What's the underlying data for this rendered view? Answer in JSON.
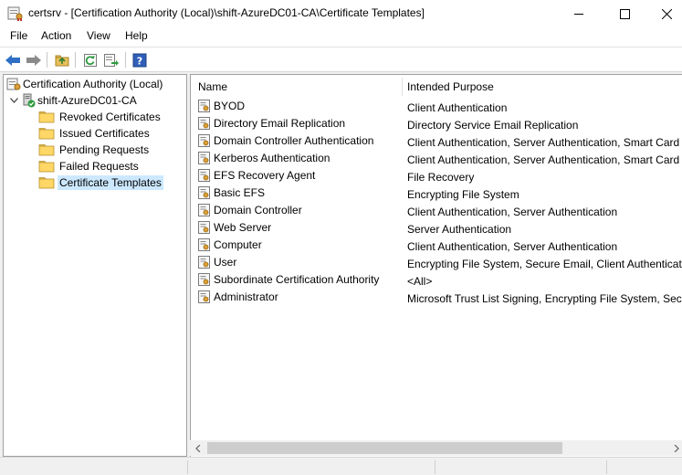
{
  "window": {
    "title": "certsrv - [Certification Authority (Local)\\shift-AzureDC01-CA\\Certificate Templates]"
  },
  "menu": [
    "File",
    "Action",
    "View",
    "Help"
  ],
  "toolbar": {
    "icons": [
      "back-arrow-icon",
      "forward-arrow-icon",
      "up-folder-icon",
      "refresh-icon",
      "export-list-icon",
      "help-icon"
    ]
  },
  "tree": {
    "root": "Certification Authority (Local)",
    "ca": "shift-AzureDC01-CA",
    "children": [
      "Revoked Certificates",
      "Issued Certificates",
      "Pending Requests",
      "Failed Requests",
      "Certificate Templates"
    ],
    "selected": "Certificate Templates"
  },
  "list": {
    "columns": [
      "Name",
      "Intended Purpose"
    ],
    "rows": [
      {
        "name": "BYOD",
        "purpose": "Client Authentication"
      },
      {
        "name": "Directory Email Replication",
        "purpose": "Directory Service Email Replication"
      },
      {
        "name": "Domain Controller Authentication",
        "purpose": "Client Authentication, Server Authentication, Smart Card Logon"
      },
      {
        "name": "Kerberos Authentication",
        "purpose": "Client Authentication, Server Authentication, Smart Card Logon, KDC Authentication"
      },
      {
        "name": "EFS Recovery Agent",
        "purpose": "File Recovery"
      },
      {
        "name": "Basic EFS",
        "purpose": "Encrypting File System"
      },
      {
        "name": "Domain Controller",
        "purpose": "Client Authentication, Server Authentication"
      },
      {
        "name": "Web Server",
        "purpose": "Server Authentication"
      },
      {
        "name": "Computer",
        "purpose": "Client Authentication, Server Authentication"
      },
      {
        "name": "User",
        "purpose": "Encrypting File System, Secure Email, Client Authentication"
      },
      {
        "name": "Subordinate Certification Authority",
        "purpose": "<All>"
      },
      {
        "name": "Administrator",
        "purpose": "Microsoft Trust List Signing, Encrypting File System, Secure Email, Client Authentication"
      }
    ]
  },
  "colors": {
    "selection": "#cce8ff",
    "folder": "#e8c05a",
    "toolbar_blue": "#2f6fc6"
  }
}
